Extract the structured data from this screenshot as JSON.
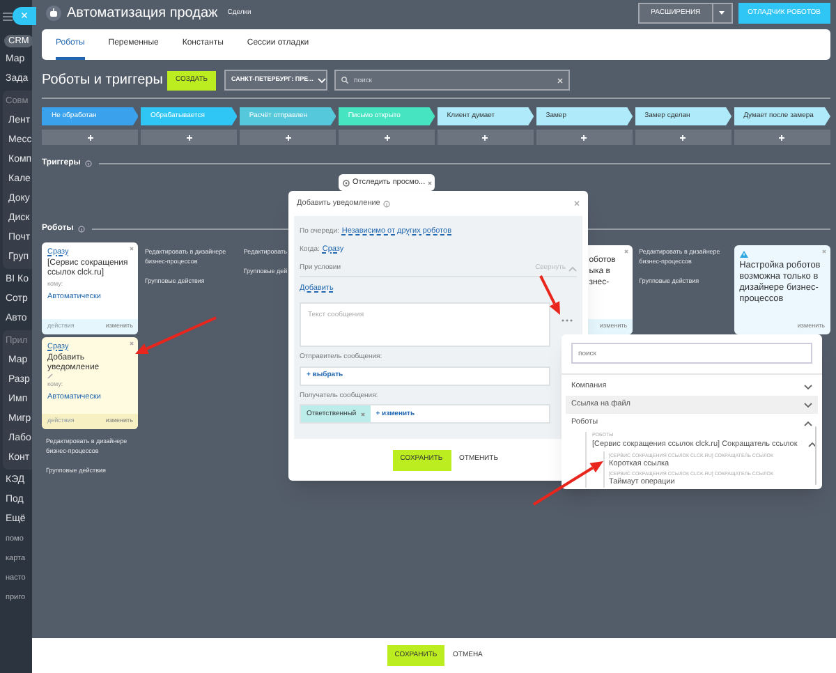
{
  "sidebar": {
    "close_button": {
      "label": "×"
    },
    "items": [
      {
        "kind": "badge",
        "label": "CRM"
      },
      {
        "kind": "item",
        "label": "Мар"
      },
      {
        "kind": "item",
        "label": "Зада"
      },
      {
        "kind": "group",
        "label": "Совм",
        "children": [
          {
            "kind": "item",
            "label": "Лент"
          },
          {
            "kind": "item",
            "label": "Месс"
          },
          {
            "kind": "item",
            "label": "Комп"
          },
          {
            "kind": "item",
            "label": "Кале"
          },
          {
            "kind": "item",
            "label": "Доку"
          },
          {
            "kind": "item",
            "label": "Диск"
          },
          {
            "kind": "item",
            "label": "Почт"
          },
          {
            "kind": "item",
            "label": "Груп"
          }
        ]
      },
      {
        "kind": "item",
        "label": "BI Ко"
      },
      {
        "kind": "item",
        "label": "Сотр"
      },
      {
        "kind": "item",
        "label": "Авто"
      },
      {
        "kind": "group",
        "label": "Прил",
        "children": [
          {
            "kind": "item",
            "label": "Мар"
          },
          {
            "kind": "item",
            "label": "Разр"
          },
          {
            "kind": "item",
            "label": "Имп"
          },
          {
            "kind": "item",
            "label": "Мигр"
          },
          {
            "kind": "item",
            "label": "Лабо"
          },
          {
            "kind": "item",
            "label": "Конт"
          }
        ]
      },
      {
        "kind": "item",
        "label": "КЭД"
      },
      {
        "kind": "item",
        "label": "Под"
      },
      {
        "kind": "item",
        "label": "Ещё"
      },
      {
        "kind": "small",
        "label": "помо"
      },
      {
        "kind": "small",
        "label": "карта"
      },
      {
        "kind": "small",
        "label": "насто"
      },
      {
        "kind": "small",
        "label": "приго"
      }
    ]
  },
  "header": {
    "title": "Автоматизация продаж",
    "subtitle": "Сделки",
    "extensions_button": "РАСШИРЕНИЯ",
    "debugger_button": "ОТЛАДЧИК РОБОТОВ"
  },
  "tabs": [
    {
      "label": "Роботы",
      "selected": true
    },
    {
      "label": "Переменные",
      "selected": false
    },
    {
      "label": "Константы",
      "selected": false
    },
    {
      "label": "Сессии отладки",
      "selected": false
    }
  ],
  "toolbar": {
    "heading": "Роботы и триггеры",
    "create_button": "СОЗДАТЬ",
    "category": "САНКТ-ПЕТЕРБУРГ: ПРЕ...",
    "search": {
      "placeholder": "поиск"
    }
  },
  "stages": [
    {
      "label": "Не обработан",
      "color": "#3aa2ec"
    },
    {
      "label": "Обрабатывается",
      "color": "#2fc6f6"
    },
    {
      "label": "Расчёт отправлен",
      "color": "#55c9db"
    },
    {
      "label": "Письмо открыто",
      "color": "#47e4c2"
    },
    {
      "label": "Клиент думает",
      "color": "#aeeaf9"
    },
    {
      "label": "Замер",
      "color": "#aeeaf9"
    },
    {
      "label": "Замер сделан",
      "color": "#aeeaf9"
    },
    {
      "label": "Думает после замера",
      "color": "#aeeaf9"
    }
  ],
  "triggers": {
    "label": "Триггеры",
    "trigger": "Отследить просмо..."
  },
  "robots": {
    "label": "Роботы",
    "columns": [
      {
        "cards": [
          {
            "kind": "robot",
            "highlighted": false,
            "edit_icon": false,
            "delay": "Сразу",
            "title": "[Сервис сокращения ссылок clck.ru]",
            "to_label": "кому:",
            "to_value": "Автоматически",
            "footer_left": "действия",
            "footer_right": "изменить"
          },
          {
            "kind": "robot",
            "highlighted": true,
            "edit_icon": true,
            "delay": "Сразу",
            "title": "Добавить уведомление",
            "to_label": "кому:",
            "to_value": "Автоматически",
            "footer_left": "действия",
            "footer_right": "изменить"
          }
        ],
        "links": [
          "Редактировать в дизайнере бизнес-процессов",
          "Групповые действия"
        ]
      },
      {
        "links": [
          "Редактировать в дизайнере бизнес-процессов",
          "Групповые действия"
        ]
      },
      {
        "links": [
          "Редактировать",
          "Групповые дей"
        ]
      },
      {},
      {},
      {
        "cards": [
          {
            "kind": "partial",
            "lines": [
              "оботов",
              "ыка в",
              "знес-"
            ],
            "footer_right": "изменить"
          }
        ]
      },
      {
        "links": [
          "Редактировать в дизайнере бизнес-процессов",
          "Групповые действия"
        ]
      },
      {
        "cards": [
          {
            "kind": "warning",
            "text": "Настройка роботов возможна только в дизайнере бизнес-процессов",
            "footer_right": "изменить"
          }
        ]
      }
    ]
  },
  "dialog": {
    "title": "Добавить уведомление",
    "order_label": "По очереди:",
    "order_value": "Независимо от других роботов",
    "when_label": "Когда:",
    "when_value": "Сразу",
    "condition_label": "При условии",
    "collapse": "Свернуть",
    "add_link": "Добавить",
    "message": {
      "placeholder": "Текст сообщения"
    },
    "sender_label": "Отправитель сообщения:",
    "sender_action": "+ выбрать",
    "recipient_label": "Получатель сообщения:",
    "recipient_tag": "Ответственный",
    "recipient_action": "+ изменить",
    "save": "СОХРАНИТЬ",
    "cancel": "ОТМЕНИТЬ"
  },
  "field_menu": {
    "search": {
      "placeholder": "поиск"
    },
    "items": [
      {
        "label": "Компания",
        "expanded": false,
        "highlighted": false
      },
      {
        "label": "Ссылка на файл",
        "expanded": false,
        "highlighted": true
      },
      {
        "label": "Роботы",
        "expanded": true,
        "highlighted": false,
        "children": [
          {
            "group": "РОБОТЫ",
            "label": "[Сервис сокращения ссылок clck.ru] Сокращатель ссылок",
            "expanded": true,
            "children": [
              {
                "group": "[СЕРВИС СОКРАЩЕНИЯ ССЫЛОК CLCK.RU] СОКРАЩАТЕЛЬ ССЫЛОК",
                "label": "Короткая ссылка"
              },
              {
                "group": "[СЕРВИС СОКРАЩЕНИЯ ССЫЛОК CLCK.RU] СОКРАЩАТЕЛЬ ССЫЛОК",
                "label": "Таймаут операции"
              }
            ]
          }
        ]
      }
    ]
  },
  "footer": {
    "save": "СОХРАНИТЬ",
    "cancel": "ОТМЕНА"
  }
}
